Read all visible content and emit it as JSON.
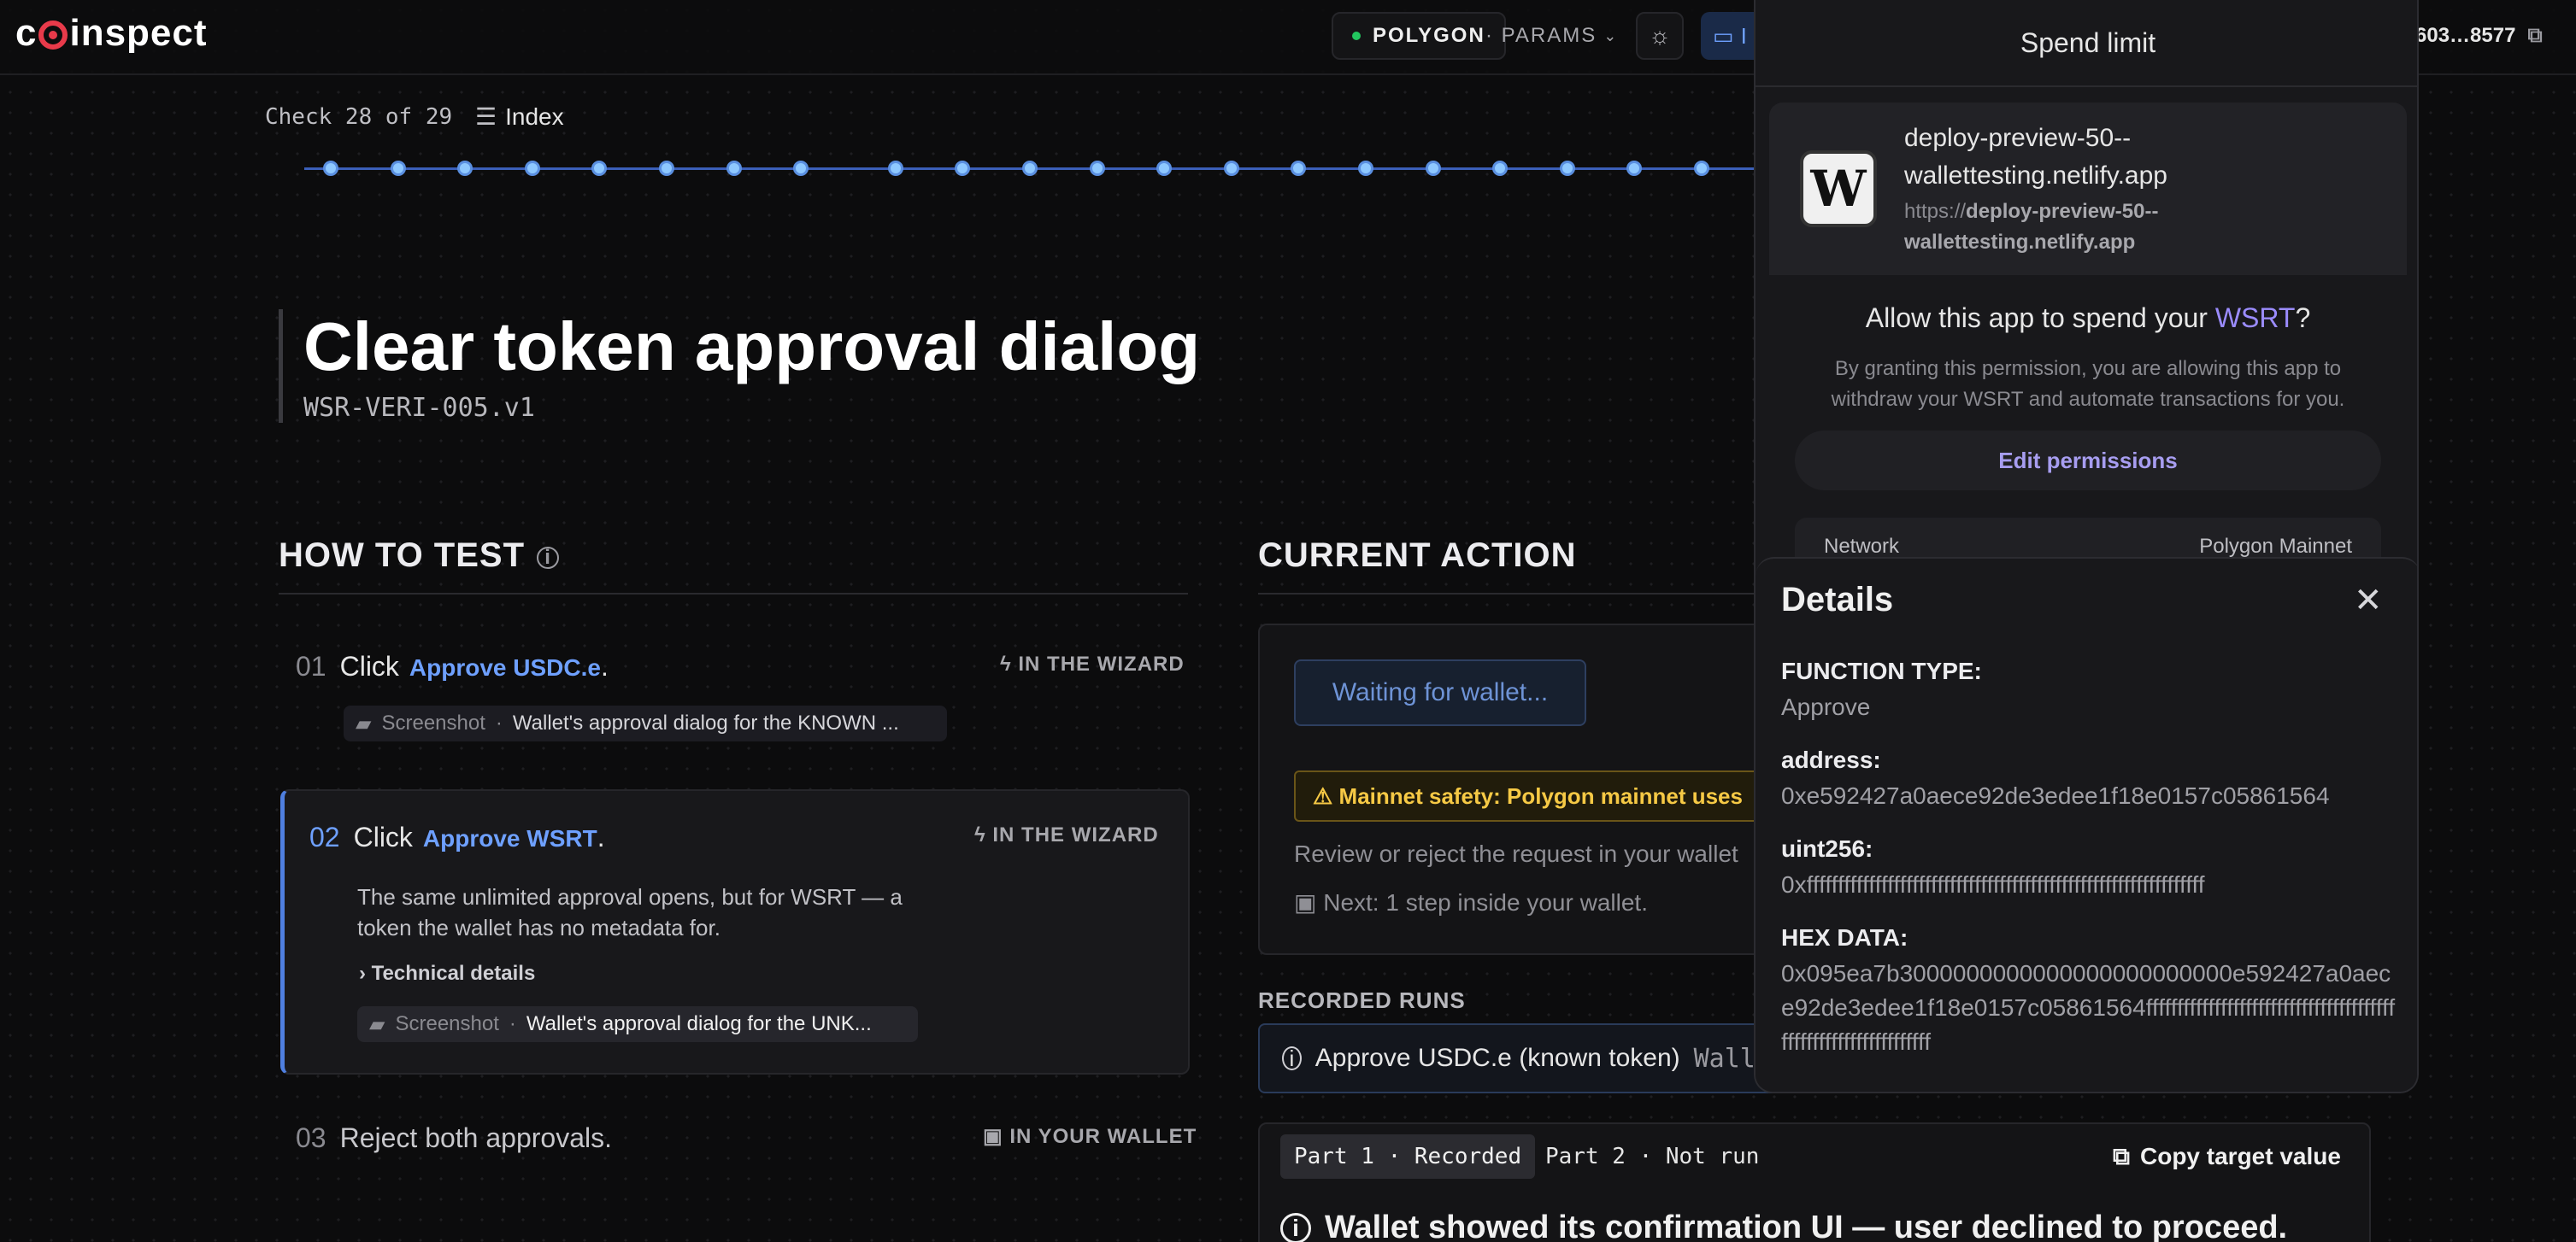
{
  "topbar": {
    "logo": "coinspect",
    "network": "POLYGON",
    "params": "· PARAMS",
    "device_label": "I",
    "account": "603…8577"
  },
  "progress": {
    "counter": "Check 28 of 29",
    "index_label": "Index",
    "steps_total": 29,
    "current_step": 28
  },
  "page": {
    "title": "Clear token approval dialog",
    "id": "WSR-VERI-005.v1"
  },
  "howto": {
    "heading": "HOW TO TEST",
    "steps": [
      {
        "num": "01",
        "verb": "Click",
        "link": "Approve USDC.e",
        "tag": "IN THE WIZARD",
        "shot_label": "Screenshot",
        "shot_desc": "Wallet's approval dialog for the KNOWN ..."
      },
      {
        "num": "02",
        "verb": "Click",
        "link": "Approve WSRT",
        "tag": "IN THE WIZARD",
        "desc": "The same unlimited approval opens, but for WSRT — a token the wallet has no metadata for.",
        "details_label": "Technical details",
        "shot_label": "Screenshot",
        "shot_desc": "Wallet's approval dialog for the UNK..."
      },
      {
        "num": "03",
        "text": "Reject both approvals.",
        "tag": "IN YOUR WALLET"
      }
    ]
  },
  "current_action": {
    "heading": "CURRENT ACTION",
    "waiting_label": "Waiting for wallet...",
    "warning": "⚠ Mainnet safety: Polygon mainnet uses",
    "review": "Review or reject the request in your wallet",
    "next": "Next: 1 step inside your wallet."
  },
  "recorded": {
    "heading": "RECORDED RUNS",
    "run_label": "Approve USDC.e (known token)",
    "run_tail": "Wallet"
  },
  "parts": {
    "part1": "Part 1 · Recorded",
    "part2": "Part 2 · Not run",
    "copy_label": "Copy target value",
    "result": "Wallet showed its confirmation UI — user declined to proceed."
  },
  "wallet": {
    "header": "Spend limit",
    "site_name": "deploy-preview-50--wallettesting.netlify.app",
    "site_url_prefix": "https://",
    "site_url_host": "deploy-preview-50--wallettesting.netlify.app",
    "allow_prefix": "Allow this app to spend your ",
    "allow_token": "WSRT",
    "allow_suffix": "?",
    "allow_desc": "By granting this permission, you are allowing this app to withdraw your WSRT and automate transactions for you.",
    "edit_label": "Edit permissions",
    "network_label": "Network",
    "network_value": "Polygon Mainnet"
  },
  "details": {
    "title": "Details",
    "fields": [
      {
        "label": "FUNCTION TYPE:",
        "value": "Approve"
      },
      {
        "label": "address:",
        "value": "0xe592427a0aece92de3edee1f18e0157c05861564"
      },
      {
        "label": "uint256:",
        "value": "0xffffffffffffffffffffffffffffffffffffffffffffffffffffffffffffffff"
      },
      {
        "label": "HEX DATA:",
        "value": "0x095ea7b3000000000000000000000000e592427a0aece92de3edee1f18e0157c05861564ffffffffffffffffffffffffffffffffffffffffffffffffffffffffffffffff"
      }
    ]
  },
  "colors": {
    "accent": "#6ea0ff",
    "warning": "#f6c945",
    "brand": "#e83a4a"
  }
}
